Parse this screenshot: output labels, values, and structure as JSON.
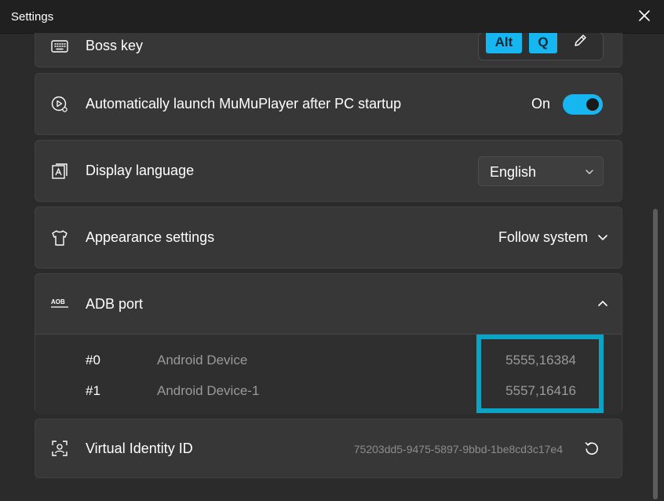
{
  "window": {
    "title": "Settings"
  },
  "boss_key": {
    "label": "Boss key",
    "keys": [
      "Alt",
      "Q"
    ]
  },
  "auto_launch": {
    "label": "Automatically launch MuMuPlayer after PC startup",
    "state_text": "On",
    "enabled": true
  },
  "display_language": {
    "label": "Display language",
    "value": "English"
  },
  "appearance": {
    "label": "Appearance settings",
    "value": "Follow system"
  },
  "adb_port": {
    "label": "ADB port",
    "icon_text": "AOB",
    "devices": [
      {
        "index": "#0",
        "name": "Android Device",
        "ports": "5555,16384"
      },
      {
        "index": "#1",
        "name": "Android Device-1",
        "ports": "5557,16416"
      }
    ]
  },
  "virtual_identity": {
    "label": "Virtual Identity ID",
    "value": "75203dd5-9475-5897-9bbd-1be8cd3c17e4"
  },
  "colors": {
    "accent": "#16b6f0",
    "highlight_box": "#0aa5c6",
    "background": "#2b2b2b",
    "card": "#373737"
  }
}
